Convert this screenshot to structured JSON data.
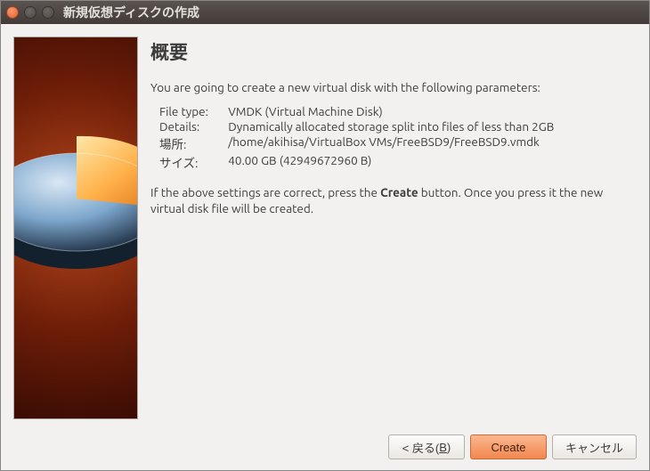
{
  "window": {
    "title": "新規仮想ディスクの作成"
  },
  "heading": "概要",
  "intro": "You are going to create a new virtual disk with the following parameters:",
  "details": {
    "file_type_label": "File type:",
    "file_type_value": "VMDK (Virtual Machine Disk)",
    "details_label": "Details:",
    "details_value": "Dynamically allocated storage split into files of less than 2GB",
    "location_label": "場所:",
    "location_value": "/home/akihisa/VirtualBox VMs/FreeBSD9/FreeBSD9.vmdk",
    "size_label": "サイズ:",
    "size_value": "40.00 GB (42949672960 B)"
  },
  "outro_pre": "If the above settings are correct, press the ",
  "outro_bold": "Create",
  "outro_post": " button. Once you press it the new virtual disk file will be created.",
  "buttons": {
    "back_pre": "< 戻る(",
    "back_mnemonic": "B",
    "back_post": ")",
    "create": "Create",
    "cancel": "キャンセル"
  }
}
